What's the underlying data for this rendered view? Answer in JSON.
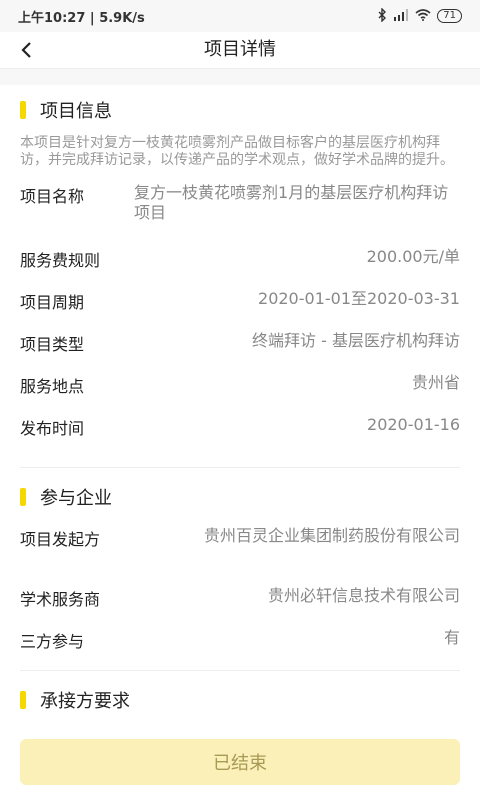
{
  "status": {
    "time": "上午10:27",
    "speed": "5.9K/s",
    "battery": "71"
  },
  "header": {
    "title": "项目详情"
  },
  "project_info": {
    "title": "项目信息",
    "description": "本项目是针对复方一枝黄花喷雾剂产品做目标客户的基层医疗机构拜访，并完成拜访记录，以传递产品的学术观点，做好学术品牌的提升。",
    "rows": [
      {
        "label": "项目名称",
        "value": "复方一枝黄花喷雾剂1月的基层医疗机构拜访项目"
      },
      {
        "label": "服务费规则",
        "value": "200.00元/单"
      },
      {
        "label": "项目周期",
        "value": "2020-01-01至2020-03-31"
      },
      {
        "label": "项目类型",
        "value": "终端拜访 - 基层医疗机构拜访"
      },
      {
        "label": "服务地点",
        "value": "贵州省"
      },
      {
        "label": "发布时间",
        "value": "2020-01-16"
      }
    ]
  },
  "companies": {
    "title": "参与企业",
    "rows": [
      {
        "label": "项目发起方",
        "value": "贵州百灵企业集团制药股份有限公司"
      },
      {
        "label": "学术服务商",
        "value": "贵州必轩信息技术有限公司"
      },
      {
        "label": "三方参与",
        "value": "有"
      }
    ]
  },
  "requirements": {
    "title": "承接方要求"
  },
  "footer": {
    "button_label": "已结束"
  },
  "colors": {
    "accent": "#f5d800",
    "button_bg": "#fbf1b8"
  }
}
